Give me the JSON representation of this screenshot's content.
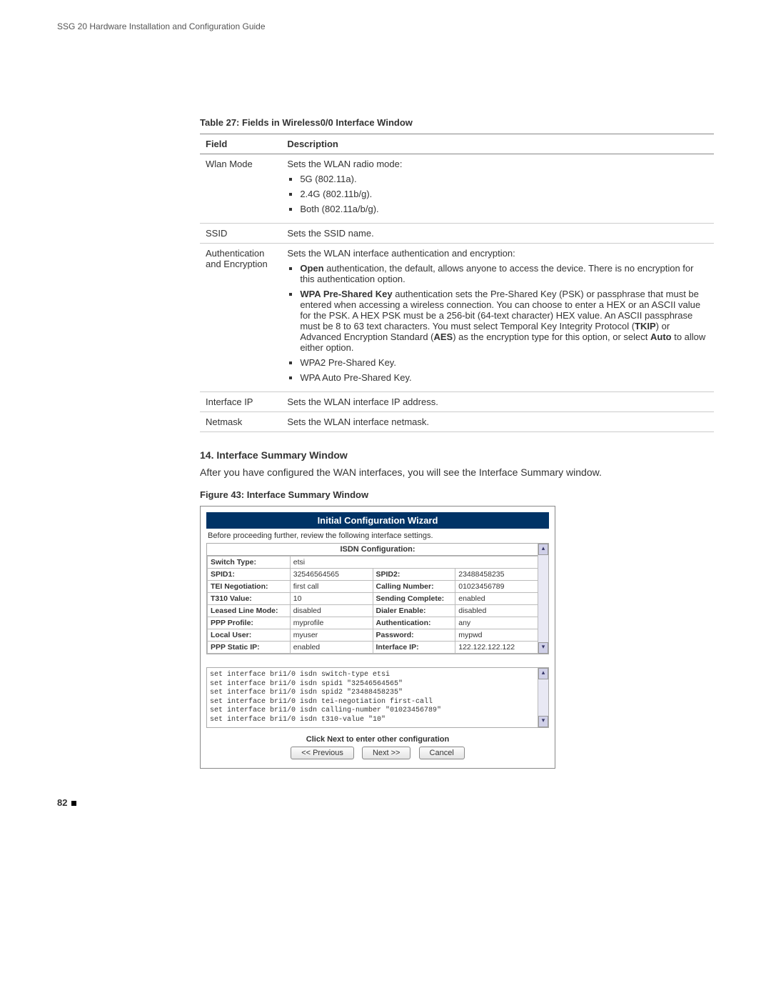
{
  "header": "SSG 20 Hardware Installation and Configuration Guide",
  "table_caption": "Table 27:  Fields in Wireless0/0 Interface Window",
  "columns": {
    "field": "Field",
    "desc": "Description"
  },
  "rows": {
    "wlan_mode": {
      "field": "Wlan Mode",
      "desc": "Sets the WLAN radio mode:",
      "bullets": [
        "5G (802.11a).",
        "2.4G (802.11b/g).",
        "Both (802.11a/b/g)."
      ]
    },
    "ssid": {
      "field": "SSID",
      "desc": "Sets the SSID name."
    },
    "auth": {
      "field": "Authentication and Encryption",
      "desc": "Sets the WLAN interface authentication and encryption:",
      "b1_prefix": "Open",
      "b1_rest": " authentication, the default, allows anyone to access the device. There is no encryption for this authentication option.",
      "b2_prefix": "WPA Pre-Shared Key",
      "b2_mid1": " authentication sets the Pre-Shared Key (PSK) or passphrase that must be entered when accessing a wireless connection. You can choose to enter a HEX or an ASCII value for the PSK. A HEX PSK must be a 256-bit (64-text character) HEX value. An ASCII passphrase must be 8 to 63 text characters. You must select Temporal Key Integrity Protocol (",
      "b2_tkip": "TKIP",
      "b2_mid2": ") or Advanced Encryption Standard (",
      "b2_aes": "AES",
      "b2_mid3": ") as the encryption type for this option, or select ",
      "b2_auto": "Auto",
      "b2_end": " to allow either option.",
      "b3": "WPA2 Pre-Shared Key.",
      "b4": "WPA Auto Pre-Shared Key."
    },
    "ifip": {
      "field": "Interface IP",
      "desc": "Sets the WLAN interface IP address."
    },
    "netmask": {
      "field": "Netmask",
      "desc": "Sets the WLAN interface netmask."
    }
  },
  "section_heading": "14. Interface Summary Window",
  "section_body": "After you have configured the WAN interfaces, you will see the Interface Summary window.",
  "figure_caption": "Figure 43:  Interface Summary Window",
  "wizard": {
    "title": "Initial Configuration Wizard",
    "instruction": "Before proceeding further, review the following interface settings.",
    "isdn_head": "ISDN Configuration:",
    "labels": {
      "switch_type": "Switch Type:",
      "spid1": "SPID1:",
      "spid2": "SPID2:",
      "tei": "TEI Negotiation:",
      "calling": "Calling Number:",
      "t310": "T310 Value:",
      "sending": "Sending Complete:",
      "leased": "Leased Line Mode:",
      "dialer": "Dialer Enable:",
      "ppp_profile": "PPP Profile:",
      "auth": "Authentication:",
      "local_user": "Local User:",
      "password": "Password:",
      "ppp_static": "PPP Static IP:",
      "iface_ip": "Interface IP:"
    },
    "values": {
      "switch_type": "etsi",
      "spid1": "32546564565",
      "spid2": "23488458235",
      "tei": "first call",
      "calling": "01023456789",
      "t310": "10",
      "sending": "enabled",
      "leased": "disabled",
      "dialer": "disabled",
      "ppp_profile": "myprofile",
      "auth": "any",
      "local_user": "myuser",
      "password": "mypwd",
      "ppp_static": "enabled",
      "iface_ip": "122.122.122.122"
    },
    "cli": "set interface bri1/0 isdn switch-type etsi\nset interface bri1/0 isdn spid1 \"32546564565\"\nset interface bri1/0 isdn spid2 \"23488458235\"\nset interface bri1/0 isdn tei-negotiation first-call\nset interface bri1/0 isdn calling-number \"01023456789\"\nset interface bri1/0 isdn t310-value \"10\"",
    "click_next": "Click Next to enter other configuration",
    "prev": "<< Previous",
    "next": "Next >>",
    "cancel": "Cancel"
  },
  "page_number": "82"
}
